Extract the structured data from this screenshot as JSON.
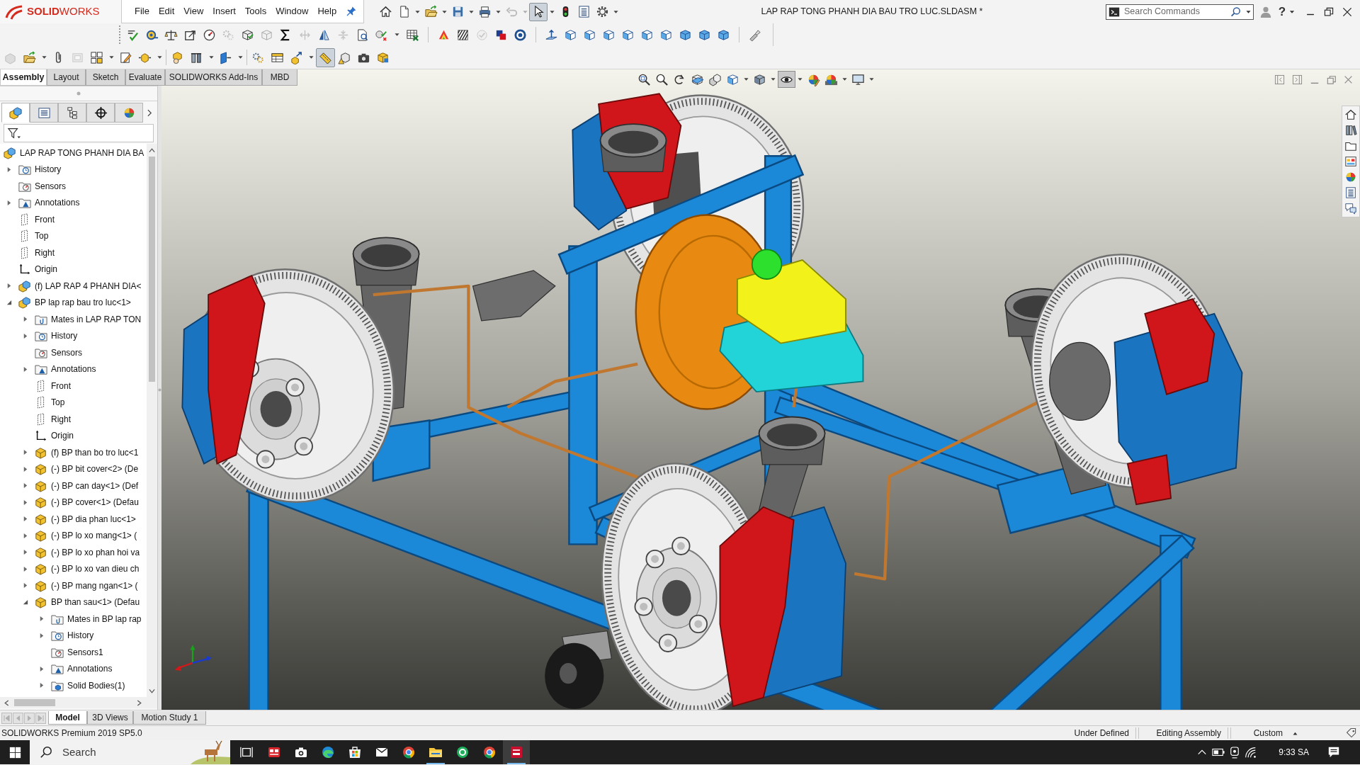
{
  "logo": {
    "text": "**SOLID**WORKS"
  },
  "menu": [
    "File",
    "Edit",
    "View",
    "Insert",
    "Tools",
    "Window",
    "Help"
  ],
  "quick_access_toolbar": [
    {
      "kind": "home",
      "selected": false,
      "disabled": false
    },
    {
      "kind": "new-document",
      "selected": false,
      "disabled": false
    },
    {
      "kind": "caret",
      "selected": false,
      "disabled": false
    },
    {
      "kind": "open-folder",
      "selected": false,
      "disabled": false
    },
    {
      "kind": "caret",
      "selected": false,
      "disabled": false
    },
    {
      "kind": "save",
      "selected": false,
      "disabled": false
    },
    {
      "kind": "caret",
      "selected": false,
      "disabled": false
    },
    {
      "kind": "printer",
      "selected": false,
      "disabled": false
    },
    {
      "kind": "caret",
      "selected": false,
      "disabled": false
    },
    {
      "kind": "undo",
      "selected": false,
      "disabled": true
    },
    {
      "kind": "caret",
      "selected": false,
      "disabled": true
    },
    {
      "kind": "pointer",
      "selected": true,
      "disabled": false
    },
    {
      "kind": "caret",
      "selected": false,
      "disabled": false
    },
    {
      "kind": "traffic-light",
      "selected": false,
      "disabled": false
    },
    {
      "kind": "list-document",
      "selected": false,
      "disabled": false
    },
    {
      "kind": "gear",
      "selected": false,
      "disabled": false
    },
    {
      "kind": "caret",
      "selected": false,
      "disabled": false
    }
  ],
  "window": {
    "title": "LAP RAP TONG PHANH DIA BAU TRO LUC.SLDASM *"
  },
  "search": {
    "placeholder": "Search Commands"
  },
  "help": "?",
  "toolbar_row_2": [
    [
      {
        "kind": "lines-check",
        "selected": false,
        "disabled": false
      },
      {
        "kind": "tape-measure",
        "selected": false,
        "disabled": false
      },
      {
        "kind": "balance-scale",
        "selected": false,
        "disabled": false
      },
      {
        "kind": "square-arrow",
        "selected": false,
        "disabled": false
      },
      {
        "kind": "gauge",
        "selected": false,
        "disabled": false
      },
      {
        "kind": "gears",
        "selected": false,
        "disabled": true
      },
      {
        "kind": "cube-check",
        "selected": false,
        "disabled": false
      },
      {
        "kind": "cube",
        "selected": false,
        "disabled": true
      },
      {
        "kind": "sigma",
        "selected": false,
        "disabled": false
      },
      {
        "kind": "arrows",
        "selected": false,
        "disabled": true
      },
      {
        "kind": "mirror",
        "selected": false,
        "disabled": false
      },
      {
        "kind": "compress",
        "selected": false,
        "disabled": true
      },
      {
        "kind": "document-search",
        "selected": false,
        "disabled": false
      },
      {
        "kind": "check-cross",
        "selected": false,
        "disabled": false
      },
      {
        "kind": "caret",
        "selected": false,
        "disabled": false
      },
      {
        "kind": "spreadsheet",
        "selected": false,
        "disabled": false
      }
    ],
    [
      {
        "kind": "rainbow",
        "selected": false,
        "disabled": false
      },
      {
        "kind": "zebra",
        "selected": false,
        "disabled": false
      },
      {
        "kind": "check-circle",
        "selected": false,
        "disabled": true
      },
      {
        "kind": "squares",
        "selected": false,
        "disabled": false
      },
      {
        "kind": "ring",
        "selected": false,
        "disabled": false
      }
    ],
    [
      {
        "kind": "normal-to",
        "selected": false,
        "disabled": false
      },
      {
        "kind": "cube-face",
        "selected": false,
        "disabled": false
      },
      {
        "kind": "cube-face",
        "selected": false,
        "disabled": false
      },
      {
        "kind": "cube-face",
        "selected": false,
        "disabled": false
      },
      {
        "kind": "cube-face",
        "selected": false,
        "disabled": false
      },
      {
        "kind": "cube-face",
        "selected": false,
        "disabled": false
      },
      {
        "kind": "cube-face",
        "selected": false,
        "disabled": false
      },
      {
        "kind": "cube-solid",
        "selected": false,
        "disabled": false
      },
      {
        "kind": "cube-solid",
        "selected": false,
        "disabled": false
      },
      {
        "kind": "cube-solid",
        "selected": false,
        "disabled": false
      }
    ],
    [
      {
        "kind": "flashlight",
        "selected": false,
        "disabled": false
      }
    ]
  ],
  "toolbar_row_3": [
    [
      {
        "kind": "block",
        "selected": false,
        "disabled": true
      },
      {
        "kind": "open-folder",
        "selected": false,
        "disabled": false
      },
      {
        "kind": "caret",
        "selected": false,
        "disabled": false
      },
      {
        "kind": "paperclip",
        "selected": false,
        "disabled": false
      },
      {
        "kind": "frame",
        "selected": false,
        "disabled": true
      },
      {
        "kind": "grid",
        "selected": false,
        "disabled": false
      },
      {
        "kind": "caret",
        "selected": false,
        "disabled": false
      },
      {
        "kind": "pencil-document",
        "selected": false,
        "disabled": false
      },
      {
        "kind": "cube-arrows",
        "selected": false,
        "disabled": false
      },
      {
        "kind": "caret",
        "selected": false,
        "disabled": false
      }
    ],
    [
      {
        "kind": "block-hand",
        "selected": false,
        "disabled": false
      },
      {
        "kind": "pillars",
        "selected": false,
        "disabled": false
      },
      {
        "kind": "caret",
        "selected": false,
        "disabled": false
      },
      {
        "kind": "panel-arrow",
        "selected": false,
        "disabled": false
      },
      {
        "kind": "caret",
        "selected": false,
        "disabled": false
      }
    ],
    [
      {
        "kind": "gears",
        "selected": false,
        "disabled": false
      },
      {
        "kind": "table",
        "selected": false,
        "disabled": false
      },
      {
        "kind": "arrow-block",
        "selected": false,
        "disabled": false
      },
      {
        "kind": "caret",
        "selected": false,
        "disabled": false
      },
      {
        "kind": "ruler",
        "selected": true,
        "disabled": false
      },
      {
        "kind": "warning-cube",
        "selected": false,
        "disabled": false
      },
      {
        "kind": "camera",
        "selected": false,
        "disabled": false
      },
      {
        "kind": "cube-tile",
        "selected": false,
        "disabled": false
      }
    ]
  ],
  "command_tabs": [
    {
      "label": "Assembly",
      "selected": true
    },
    {
      "label": "Layout",
      "selected": false
    },
    {
      "label": "Sketch",
      "selected": false
    },
    {
      "label": "Evaluate",
      "selected": false
    },
    {
      "label": "SOLIDWORKS Add-Ins",
      "selected": false
    },
    {
      "label": "MBD",
      "selected": false
    }
  ],
  "feature_manager": {
    "tabs": [
      {
        "selected": true
      },
      {
        "selected": false
      },
      {
        "selected": false
      },
      {
        "selected": false
      },
      {
        "selected": false
      }
    ],
    "tree": [
      {
        "label": "LAP RAP TONG PHANH DIA BA",
        "kind": "assembly",
        "expandable": false,
        "expanded": false,
        "children": [
          {
            "label": "History",
            "kind": "history",
            "expandable": true,
            "expanded": false
          },
          {
            "label": "Sensors",
            "kind": "sensors",
            "expandable": false,
            "expanded": false
          },
          {
            "label": "Annotations",
            "kind": "annotations",
            "expandable": true,
            "expanded": false
          },
          {
            "label": "Front",
            "kind": "plane",
            "expandable": false,
            "expanded": false
          },
          {
            "label": "Top",
            "kind": "plane",
            "expandable": false,
            "expanded": false
          },
          {
            "label": "Right",
            "kind": "plane",
            "expandable": false,
            "expanded": false
          },
          {
            "label": "Origin",
            "kind": "origin",
            "expandable": false,
            "expanded": false
          },
          {
            "label": "(f) LAP RAP 4 PHANH DIA<",
            "kind": "assembly",
            "expandable": true,
            "expanded": false
          },
          {
            "label": "BP lap rap bau tro luc<1>",
            "kind": "assembly",
            "expandable": true,
            "expanded": true,
            "children": [
              {
                "label": "Mates in LAP RAP TON",
                "kind": "mates",
                "expandable": true,
                "expanded": false
              },
              {
                "label": "History",
                "kind": "history",
                "expandable": true,
                "expanded": false
              },
              {
                "label": "Sensors",
                "kind": "sensors",
                "expandable": false,
                "expanded": false
              },
              {
                "label": "Annotations",
                "kind": "annotations",
                "expandable": true,
                "expanded": false
              },
              {
                "label": "Front",
                "kind": "plane",
                "expandable": false,
                "expanded": false
              },
              {
                "label": "Top",
                "kind": "plane",
                "expandable": false,
                "expanded": false
              },
              {
                "label": "Right",
                "kind": "plane",
                "expandable": false,
                "expanded": false
              },
              {
                "label": "Origin",
                "kind": "origin",
                "expandable": false,
                "expanded": false
              },
              {
                "label": "(f) BP than bo tro luc<1",
                "kind": "part",
                "expandable": true,
                "expanded": false
              },
              {
                "label": "(-) BP bit cover<2> (De",
                "kind": "part",
                "expandable": true,
                "expanded": false
              },
              {
                "label": "(-) BP can day<1> (Def",
                "kind": "part",
                "expandable": true,
                "expanded": false
              },
              {
                "label": "(-) BP cover<1> (Defau",
                "kind": "part",
                "expandable": true,
                "expanded": false
              },
              {
                "label": "(-) BP dia phan luc<1>",
                "kind": "part",
                "expandable": true,
                "expanded": false
              },
              {
                "label": "(-) BP lo xo mang<1> (",
                "kind": "part",
                "expandable": true,
                "expanded": false
              },
              {
                "label": "(-) BP lo xo phan hoi va",
                "kind": "part",
                "expandable": true,
                "expanded": false
              },
              {
                "label": "(-) BP lo xo van dieu ch",
                "kind": "part",
                "expandable": true,
                "expanded": false
              },
              {
                "label": "(-) BP mang ngan<1> (",
                "kind": "part",
                "expandable": true,
                "expanded": false
              },
              {
                "label": "BP than sau<1> (Defau",
                "kind": "part",
                "expandable": true,
                "expanded": true,
                "children": [
                  {
                    "label": "Mates in BP lap rap",
                    "kind": "mates",
                    "expandable": true,
                    "expanded": false
                  },
                  {
                    "label": "History",
                    "kind": "history",
                    "expandable": true,
                    "expanded": false
                  },
                  {
                    "label": "Sensors1",
                    "kind": "sensors",
                    "expandable": false,
                    "expanded": false
                  },
                  {
                    "label": "Annotations",
                    "kind": "annotations",
                    "expandable": true,
                    "expanded": false
                  },
                  {
                    "label": "Solid Bodies(1)",
                    "kind": "solid-bodies",
                    "expandable": true,
                    "expanded": false
                  }
                ]
              }
            ]
          }
        ]
      }
    ]
  },
  "view_toolbar": [
    {
      "kind": "magnifier-square",
      "selected": false
    },
    {
      "kind": "magnifier",
      "selected": false
    },
    {
      "kind": "curved-arrow",
      "selected": false
    },
    {
      "kind": "cube-cut",
      "selected": false
    },
    {
      "kind": "stacked-cubes",
      "selected": false
    },
    {
      "kind": "cube-face",
      "selected": false
    },
    {
      "kind": "caret",
      "selected": false
    },
    {
      "kind": "cube-shaded",
      "selected": false
    },
    {
      "kind": "caret",
      "selected": false
    },
    {
      "kind": "eye",
      "selected": true
    },
    {
      "kind": "caret",
      "selected": false
    },
    {
      "kind": "ball-pencil",
      "selected": false
    },
    {
      "kind": "ball-scene",
      "selected": false
    },
    {
      "kind": "caret",
      "selected": false
    },
    {
      "kind": "monitor",
      "selected": false
    },
    {
      "kind": "caret",
      "selected": false
    }
  ],
  "model_tabs": [
    {
      "label": "Model",
      "selected": true
    },
    {
      "label": "3D Views",
      "selected": false
    },
    {
      "label": "Motion Study 1",
      "selected": false
    }
  ],
  "status_bar": {
    "product": "SOLIDWORKS Premium 2019 SP5.0",
    "fields": [
      {
        "label": "Under Defined",
        "kind": "text"
      },
      {
        "label": "Editing Assembly",
        "kind": "text"
      },
      {
        "label": "Custom",
        "kind": "dropdown"
      }
    ]
  },
  "taskbar": {
    "search": {
      "placeholder": "Search"
    },
    "apps": [
      {
        "kind": "tiles",
        "running": false,
        "active": false
      },
      {
        "kind": "camera",
        "running": false,
        "active": false
      },
      {
        "kind": "swirl",
        "running": false,
        "active": false
      },
      {
        "kind": "shopping-bag",
        "running": false,
        "active": false
      },
      {
        "kind": "envelope",
        "running": false,
        "active": false
      },
      {
        "kind": "color-ring",
        "running": false,
        "active": false
      },
      {
        "kind": "folder",
        "running": true,
        "active": false
      },
      {
        "kind": "ring-badge",
        "running": false,
        "active": false
      },
      {
        "kind": "color-ring",
        "running": false,
        "active": false
      },
      {
        "kind": "striped-tile",
        "running": true,
        "active": true
      }
    ],
    "clock": "9:33 SA"
  }
}
